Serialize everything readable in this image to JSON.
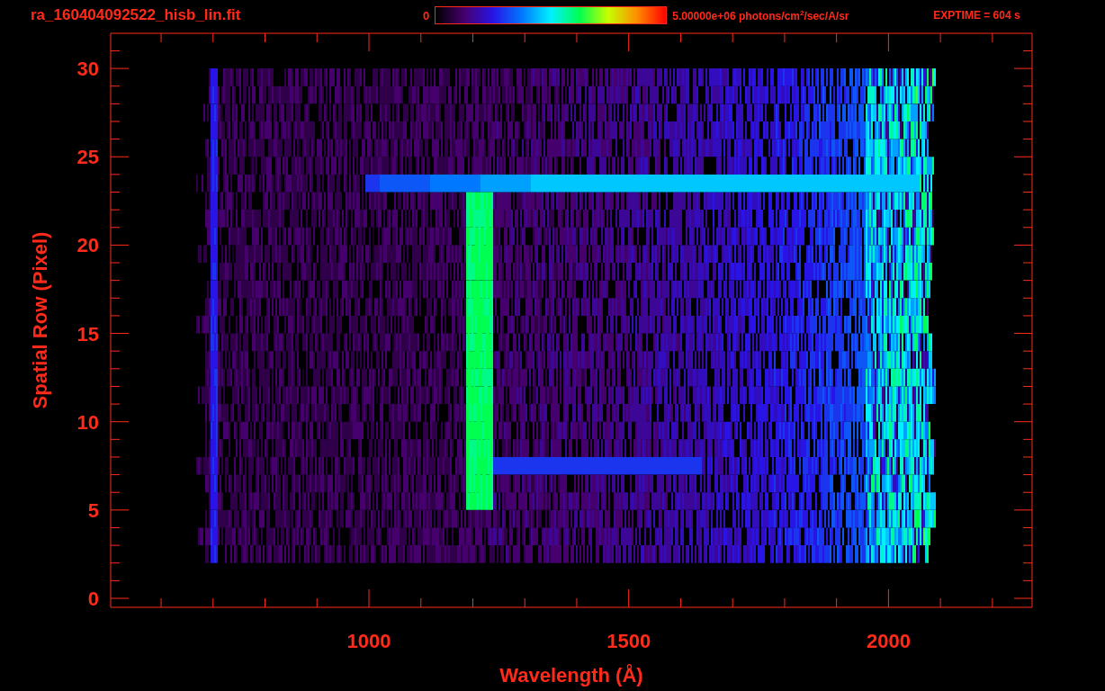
{
  "title": "ra_160404092522_hisb_lin.fit",
  "colorbar": {
    "min_label": "0",
    "max_label": "5.00000e+06 photons/cm$^{2}$/sec/A/sr"
  },
  "exposure": "EXPTIME = 604 s",
  "x_axis": {
    "label": "Wavelength (Å)",
    "ticks": [
      "1000",
      "1500",
      "2000"
    ]
  },
  "y_axis": {
    "label": "Spatial Row (Pixel)",
    "ticks": [
      "30",
      "25",
      "20",
      "15",
      "10",
      "5",
      "0"
    ]
  }
}
